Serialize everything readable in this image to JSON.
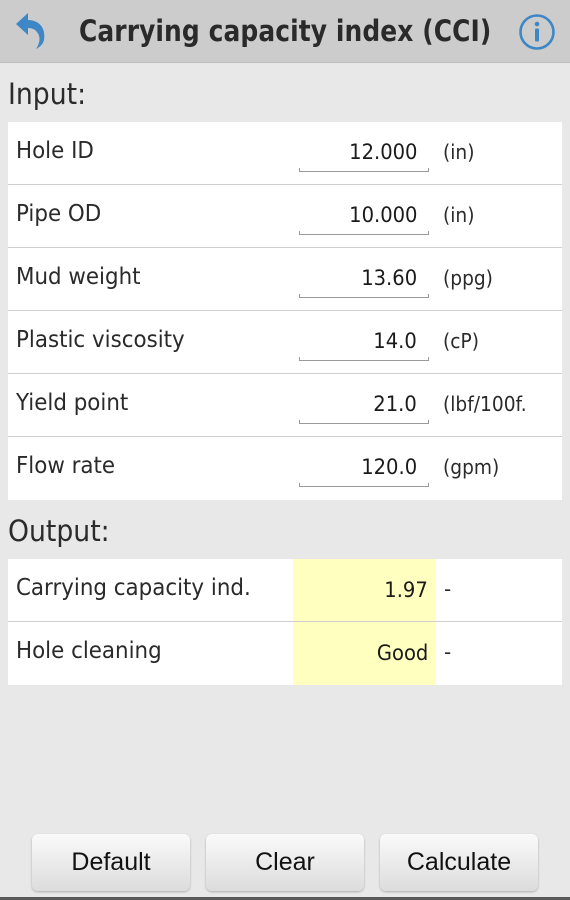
{
  "header": {
    "title": "Carrying capacity index (CCI)",
    "back_icon": "back-arrow-icon",
    "info_icon": "info-icon",
    "accent_color": "#3d87c6"
  },
  "input": {
    "section_title": "Input:",
    "fields": [
      {
        "label": "Hole ID",
        "value": "12.000",
        "unit": "(in)"
      },
      {
        "label": "Pipe OD",
        "value": "10.000",
        "unit": "(in)"
      },
      {
        "label": "Mud weight",
        "value": "13.60",
        "unit": "(ppg)"
      },
      {
        "label": "Plastic viscosity",
        "value": "14.0",
        "unit": "(cP)"
      },
      {
        "label": "Yield point",
        "value": "21.0",
        "unit": "(lbf/100f."
      },
      {
        "label": "Flow rate",
        "value": "120.0",
        "unit": "(gpm)"
      }
    ]
  },
  "output": {
    "section_title": "Output:",
    "highlight_color": "#ffffc0",
    "fields": [
      {
        "label": "Carrying capacity ind.",
        "value": "1.97",
        "unit": "-"
      },
      {
        "label": "Hole cleaning",
        "value": "Good",
        "unit": "-"
      }
    ]
  },
  "buttons": {
    "default_label": "Default",
    "clear_label": "Clear",
    "calculate_label": "Calculate"
  }
}
